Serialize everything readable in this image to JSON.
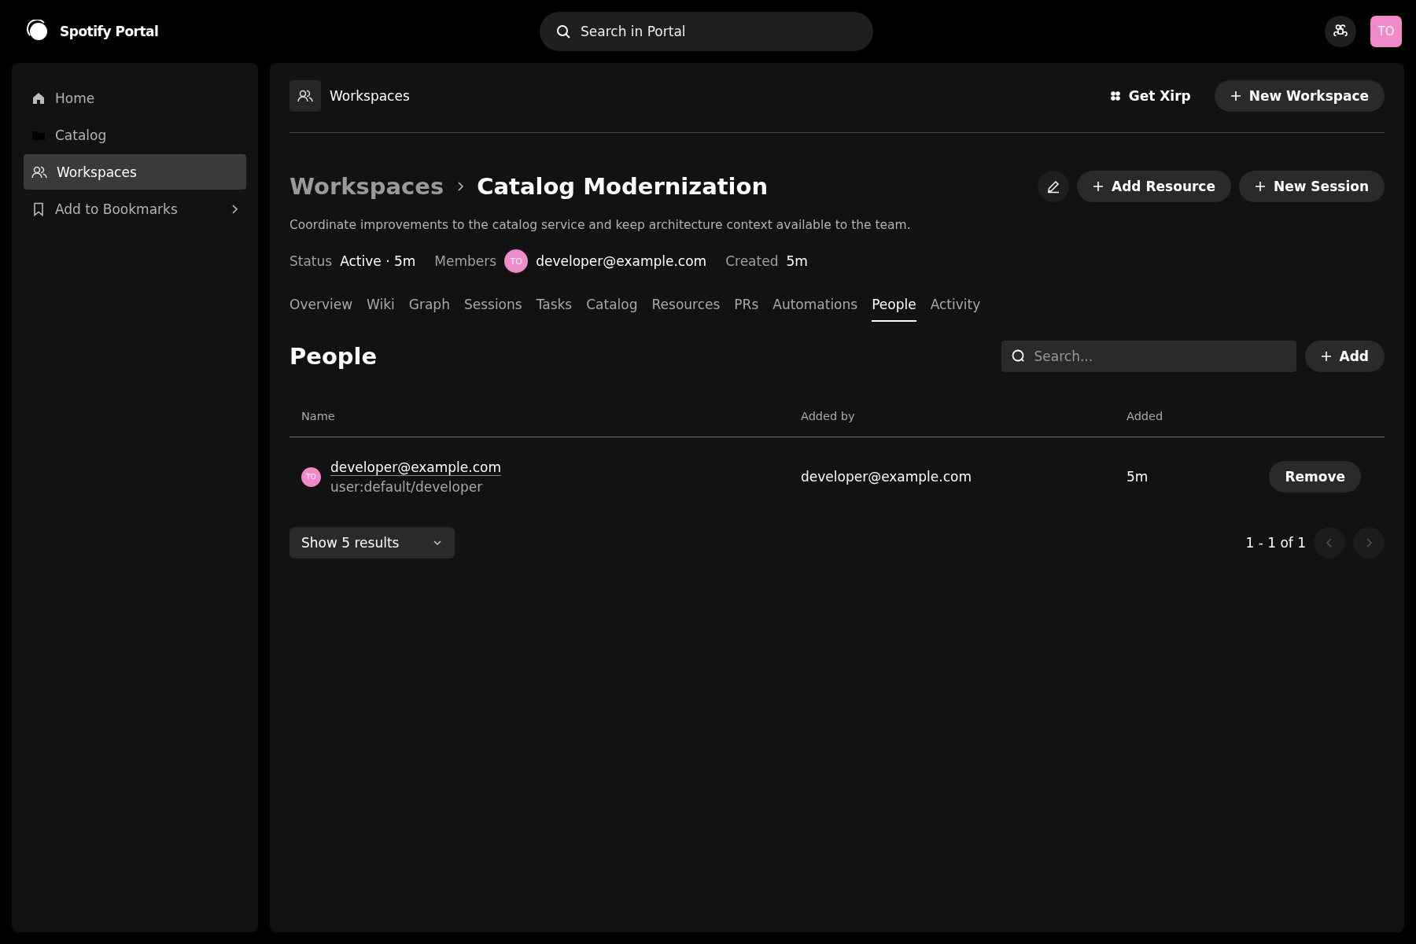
{
  "topbar": {
    "brand": "Spotify Portal",
    "search": {
      "placeholder": "Search in Portal"
    },
    "avatar": "TO"
  },
  "sidebar": {
    "items": [
      {
        "label": "Home",
        "selected": false
      },
      {
        "label": "Catalog",
        "selected": false
      },
      {
        "label": "Workspaces",
        "selected": true
      },
      {
        "label": "Add to Bookmarks",
        "selected": false
      }
    ]
  },
  "header": {
    "title": "Workspaces",
    "actions": [
      {
        "label": "Get Xirp",
        "kind": "plain"
      },
      {
        "label": "New Workspace",
        "kind": "pill"
      }
    ]
  },
  "breadcrumb": {
    "parent": "Workspaces",
    "current": "Catalog Modernization"
  },
  "page_actions": [
    "Add Resource",
    "New Session"
  ],
  "description": "Coordinate improvements to the catalog service and keep architecture context available to the team.",
  "meta": {
    "status_label": "Status",
    "status": "Active · 5m",
    "members_label": "Members",
    "member_avatar": "TO",
    "member": "developer@example.com",
    "created_label": "Created",
    "created": "5m"
  },
  "tabs": [
    {
      "label": "Overview",
      "selected": false
    },
    {
      "label": "Wiki",
      "selected": false
    },
    {
      "label": "Graph",
      "selected": false
    },
    {
      "label": "Sessions",
      "selected": false
    },
    {
      "label": "Tasks",
      "selected": false
    },
    {
      "label": "Catalog",
      "selected": false
    },
    {
      "label": "Resources",
      "selected": false
    },
    {
      "label": "PRs",
      "selected": false
    },
    {
      "label": "Automations",
      "selected": false
    },
    {
      "label": "People",
      "selected": true
    },
    {
      "label": "Activity",
      "selected": false
    }
  ],
  "section": {
    "title": "People",
    "search": {
      "placeholder": "Search..."
    },
    "add": "Add"
  },
  "table": {
    "columns": [
      "Name",
      "Added by",
      "Added"
    ],
    "rows": [
      {
        "avatar": "TO",
        "name": "developer@example.com",
        "ref": "user:default/developer",
        "added_by": "developer@example.com",
        "added": "5m",
        "action": "Remove"
      }
    ]
  },
  "pagination": {
    "page_size": "Show 5 results",
    "range": "1 - 1 of 1",
    "prev_disabled": true,
    "next_disabled": true
  }
}
